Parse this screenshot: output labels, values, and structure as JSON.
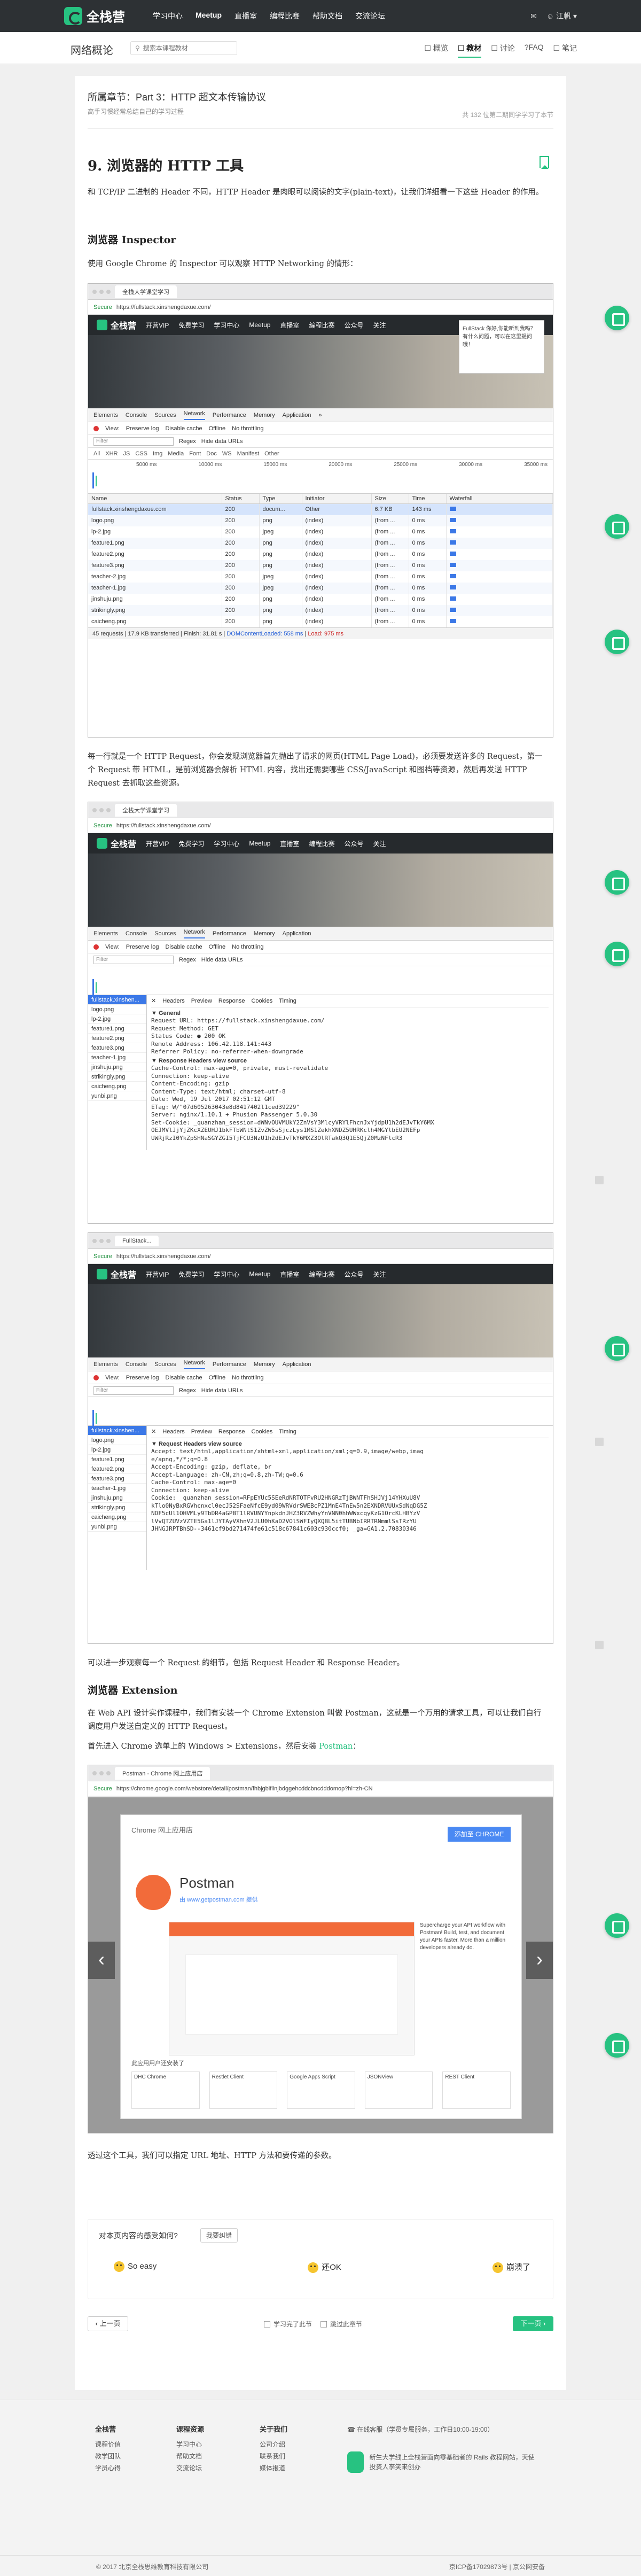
{
  "topnav": {
    "logo_text": "全栈营",
    "links": [
      "学习中心",
      "Meetup",
      "直播室",
      "编程比赛",
      "帮助文档",
      "交流论坛"
    ],
    "right": [
      "✉",
      "☺ 江帆 ▾"
    ]
  },
  "subheader": {
    "title": "网络概论",
    "search_placeholder": "搜索本课程教材",
    "tabs": [
      "☐ 概览",
      "☐ 教材",
      "☐ 讨论",
      "?FAQ",
      "☐ 笔记"
    ]
  },
  "chapter": {
    "title": "所属章节：Part 3：HTTP 超文本传输协议",
    "subtitle": "高手习惯经常总结自己的学习过程",
    "right": "共 132 位第二期同学学习了本节"
  },
  "article": {
    "h1": "9. 浏览器的 HTTP 工具",
    "p1": "和 TCP/IP 二进制的 Header 不同，HTTP Header 是肉眼可以阅读的文字(plain-text)，让我们详细看一下这些 Header 的作用。",
    "h2_inspector": "浏览器 Inspector",
    "p2": "使用 Google Chrome 的 Inspector 可以观察 HTTP Networking 的情形：",
    "p3": "每一行就是一个 HTTP Request，你会发现浏览器首先抛出了请求的网页(HTML Page Load)，必须要发送许多的 Request，第一个 Request 带 HTML，是前浏览器会解析 HTML 内容，找出还需要哪些 CSS/JavaScript 和图档等资源，然后再发送 HTTP Request 去抓取这些资源。",
    "p4": "可以进一步观察每一个 Request 的细节，包括 Request Header 和 Response Header。",
    "h2_extension": "浏览器 Extension",
    "p5": "在 Web API 设计实作课程中，我们有安装一个 Chrome Extension 叫做 Postman，这就是一个万用的请求工具，可以让我们自行调度用户发送自定义的 HTTP Request。",
    "p6_pre": "首先进入 Chrome 选单上的 Windows > Extensions，然后安装",
    "p6_link": "Postman",
    "p6_post": "：",
    "p7": "透过这个工具，我们可以指定 URL 地址、HTTP 方法和要传递的参数。"
  },
  "devtools": {
    "chrome_tab": "全栈大学课堂学习",
    "url": "https://fullstack.xinshengdaxue.com/",
    "secure": "Secure",
    "site_nav": [
      "全栈营",
      "开营VIP",
      "免费学习",
      "学习中心",
      "Meetup",
      "直播室",
      "编程比赛",
      "公众号",
      "关注"
    ],
    "popup_text": "FullStack 你好,你能听到我吗？有什么问题，可以在这里提问哦！",
    "tabs": [
      "Elements",
      "Console",
      "Sources",
      "Network",
      "Performance",
      "Memory",
      "Application",
      "»"
    ],
    "toolbar": [
      "View:",
      "Preserve log",
      "Disable cache",
      "Offline",
      "No throttling"
    ],
    "filter_placeholder": "Filter",
    "filter_opts": [
      "Regex",
      "Hide data URLs"
    ],
    "types": [
      "All",
      "XHR",
      "JS",
      "CSS",
      "Img",
      "Media",
      "Font",
      "Doc",
      "WS",
      "Manifest",
      "Other"
    ],
    "ticks": [
      "5000 ms",
      "10000 ms",
      "15000 ms",
      "20000 ms",
      "25000 ms",
      "30000 ms",
      "35000 ms"
    ],
    "columns": [
      "Name",
      "Status",
      "Type",
      "Initiator",
      "Size",
      "Time",
      "Waterfall"
    ],
    "rows": [
      [
        "fullstack.xinshengdaxue.com",
        "200",
        "docum...",
        "Other",
        "6.7 KB",
        "143 ms"
      ],
      [
        "logo.png",
        "200",
        "png",
        "(index)",
        "(from ...",
        "0 ms"
      ],
      [
        "lp-2.jpg",
        "200",
        "jpeg",
        "(index)",
        "(from ...",
        "0 ms"
      ],
      [
        "feature1.png",
        "200",
        "png",
        "(index)",
        "(from ...",
        "0 ms"
      ],
      [
        "feature2.png",
        "200",
        "png",
        "(index)",
        "(from ...",
        "0 ms"
      ],
      [
        "feature3.png",
        "200",
        "png",
        "(index)",
        "(from ...",
        "0 ms"
      ],
      [
        "teacher-2.jpg",
        "200",
        "jpeg",
        "(index)",
        "(from ...",
        "0 ms"
      ],
      [
        "teacher-1.jpg",
        "200",
        "jpeg",
        "(index)",
        "(from ...",
        "0 ms"
      ],
      [
        "jinshuju.png",
        "200",
        "png",
        "(index)",
        "(from ...",
        "0 ms"
      ],
      [
        "strikingly.png",
        "200",
        "png",
        "(index)",
        "(from ...",
        "0 ms"
      ],
      [
        "caicheng.png",
        "200",
        "png",
        "(index)",
        "(from ...",
        "0 ms"
      ]
    ],
    "status_pre": "45 requests | 17.9 KB transferred | Finish: 31.81 s | ",
    "status_dom": "DOMContentLoaded: 558 ms",
    "status_sep": " | ",
    "status_load": "Load: 975 ms"
  },
  "detail1": {
    "files": [
      "fullstack.xinshen...",
      "logo.png",
      "lp-2.jpg",
      "feature1.png",
      "feature2.png",
      "feature3.png",
      "teacher-1.jpg",
      "jinshuju.png",
      "strikingly.png",
      "caicheng.png",
      "yunbi.png"
    ],
    "subtabs": [
      "✕",
      "Headers",
      "Preview",
      "Response",
      "Cookies",
      "Timing"
    ],
    "general": "▼ General",
    "lines": [
      "Request URL: https://fullstack.xinshengdaxue.com/",
      "Request Method: GET",
      "Status Code: ● 200 OK",
      "Remote Address: 106.42.118.141:443",
      "Referrer Policy: no-referrer-when-downgrade"
    ],
    "resp_head": "▼ Response Headers     view source",
    "resp_lines": [
      "Cache-Control: max-age=0, private, must-revalidate",
      "Connection: keep-alive",
      "Content-Encoding: gzip",
      "Content-Type: text/html; charset=utf-8",
      "Date: Wed, 19 Jul 2017 02:51:12 GMT",
      "ETag: W/\"07d605263043e8d8417402l1ced39229\"",
      "Server: nginx/1.10.1 + Phusion Passenger 5.0.30",
      "Set-Cookie: _quanzhan_session=dWNvOUVMUkY2ZnVsY3MlcyVRYlFhcnJxYjdpU1h2dEJvTkY6MX",
      "OEJMVlJjYjZKcXZEUHJ1bkFTbWNtS1ZvZW5sSjczLys1MS1ZekhXNDZ5UHRKclh4MGYlbEU2NEFp",
      "UWRjRzI0YkZpSHNaSGYZGI5TjFCU3NzU1h2dEJvTkY6MXZ3OlRTakQ3Q1E5QjZ0MzNFlcR3"
    ]
  },
  "detail2": {
    "chrome_tab": "FullStack...",
    "subtabs": [
      "✕",
      "Headers",
      "Preview",
      "Response",
      "Cookies",
      "Timing"
    ],
    "req_head": "▼ Request Headers     view source",
    "lines": [
      "Accept: text/html,application/xhtml+xml,application/xml;q=0.9,image/webp,imag",
      "e/apng,*/*;q=0.8",
      "Accept-Encoding: gzip, deflate, br",
      "Accept-Language: zh-CN,zh;q=0.8,zh-TW;q=0.6",
      "Cache-Control: max-age=0",
      "Connection: keep-alive",
      "Cookie: _quanzhan_session=RFpEYUc5SEeRdNRTOTFvRU2HNGRzTjBWNTFhSHJVj14YHXuU8V",
      "kTlo0NyBxRGVhcnxcl0ecJ52SFaeNfcE9yd09WRVdrSWEBcPZ1MnE4TnEw5n2EXNDRVUUxSdNqDG5Z",
      "NDF5cUl1OHVMLy9TbDR4aGPBT1lRVUNYYnpkdnJHZ3RVZWhyYnVNN0hhWWxcqyKzG1OrcKLHBYzV",
      "lVvQTZUVzVZTE5Ga1lJYTAyVXhnV2JLU0hKaD2VOlSWFIyQXQBL5itTUBNbIRRTRNmmlSsTRzYU",
      "JHNGJRPTBhSD--3461cf9bd271474fe61c518c67841c603c930ccf0; _ga=GA1.2.70830346"
    ]
  },
  "postman": {
    "chrome_tab": "Postman - Chrome 网上应用店",
    "url": "https://chrome.google.com/webstore/detail/postman/fhbjgbiflinjbdggehcddcbncdddomop?hl=zh-CN",
    "store_title": "Chrome 网上应用店",
    "name": "Postman",
    "publisher": "由 www.getpostman.com 提供",
    "add_button": "添加至 CHROME",
    "side_text": "Supercharge your API workflow with Postman! Build, test, and document your APIs faster. More than a million developers already do.",
    "related_title": "此应用用户还安装了",
    "related": [
      "DHC Chrome",
      "Restlet Client",
      "Google Apps Script",
      "JSONView",
      "REST Client"
    ]
  },
  "feedback": {
    "question": "对本页内容的感受如何?",
    "flag_btn": "我要纠错",
    "options": [
      "So easy",
      "还OK",
      "崩溃了"
    ]
  },
  "pager": {
    "prev": "‹ 上一页",
    "next": "下一页 ›",
    "mid_a": "学习完了此节",
    "mid_b": "跳过此章节"
  },
  "footer": {
    "cols": [
      {
        "title": "全栈营",
        "items": [
          "课程价值",
          "教学团队",
          "学员心得"
        ]
      },
      {
        "title": "课程资源",
        "items": [
          "学习中心",
          "帮助文档",
          "交流论坛"
        ]
      },
      {
        "title": "关于我们",
        "items": [
          "公司介绍",
          "联系我们",
          "媒体报道"
        ]
      }
    ],
    "phone": "☎ 在线客服（学员专属服务，工作日10:00-19:00）",
    "slogan": "新生大学线上全栈营面向零基础者的 Rails 教程网站，天使投资人李笑来创办",
    "copyright": "© 2017 北京全栈思维教育科技有限公司",
    "icp": "京ICP备17029873号 | 京公网安备"
  }
}
